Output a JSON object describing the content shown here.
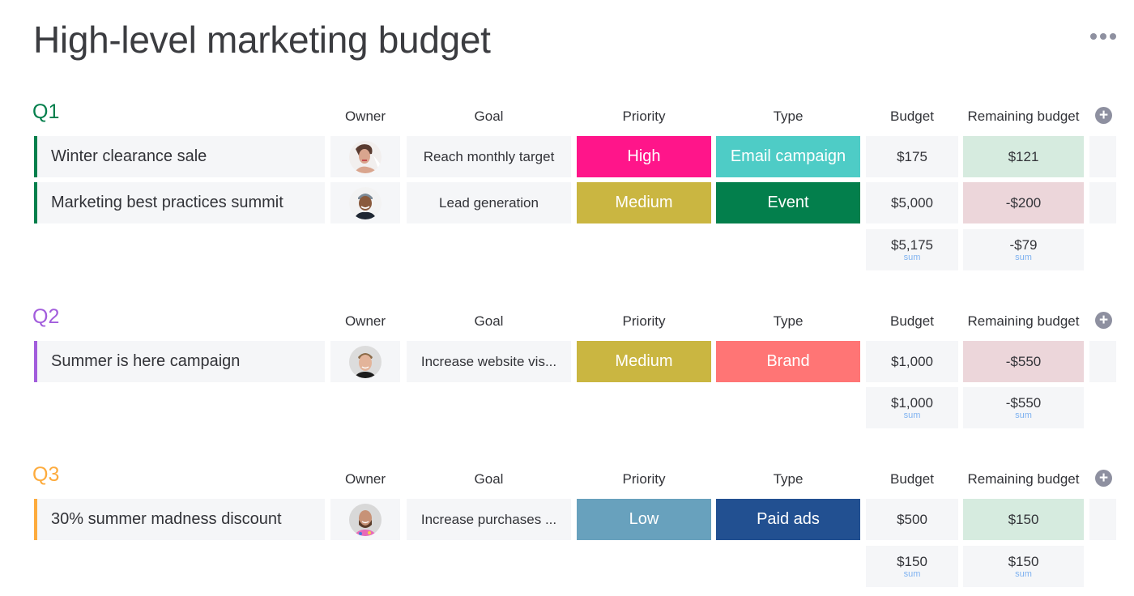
{
  "page": {
    "title": "High-level marketing budget",
    "more_icon": "more-horizontal-icon"
  },
  "columns": {
    "owner": "Owner",
    "goal": "Goal",
    "priority": "Priority",
    "type": "Type",
    "budget": "Budget",
    "remaining": "Remaining budget",
    "add_icon": "plus-circle-icon"
  },
  "colors": {
    "q1": "#037f4c",
    "q2": "#a25ddc",
    "q3": "#fdab3d",
    "high": "#ff158a",
    "medium": "#cab641",
    "low": "#68a1bd",
    "email_campaign": "#4eccc6",
    "event": "#037f4c",
    "brand": "#ff7575",
    "paid_ads": "#225091",
    "remaining_positive": "#d6ebdf",
    "remaining_negative": "#ecd6da",
    "sum_label": "#7fb2f0"
  },
  "groups": [
    {
      "title": "Q1",
      "rows": [
        {
          "name": "Winter clearance sale",
          "owner": "avatar-woman",
          "goal": "Reach monthly target",
          "priority": "High",
          "type": "Email campaign",
          "budget": "$175",
          "remaining": "$121"
        },
        {
          "name": "Marketing best practices summit",
          "owner": "avatar-man-cap",
          "goal": "Lead generation",
          "priority": "Medium",
          "type": "Event",
          "budget": "$5,000",
          "remaining": "-$200"
        }
      ],
      "sum": {
        "budget": "$5,175",
        "remaining": "-$79",
        "label": "sum"
      }
    },
    {
      "title": "Q2",
      "rows": [
        {
          "name": "Summer is here campaign",
          "owner": "avatar-man-blond",
          "goal": "Increase website vis...",
          "priority": "Medium",
          "type": "Brand",
          "budget": "$1,000",
          "remaining": "-$550"
        }
      ],
      "sum": {
        "budget": "$1,000",
        "remaining": "-$550",
        "label": "sum"
      }
    },
    {
      "title": "Q3",
      "rows": [
        {
          "name": "30% summer madness discount",
          "owner": "avatar-man-beard",
          "goal": "Increase purchases ...",
          "priority": "Low",
          "type": "Paid ads",
          "budget": "$500",
          "remaining": "$150"
        }
      ],
      "sum": {
        "budget": "$150",
        "remaining": "$150",
        "label": "sum"
      }
    }
  ]
}
